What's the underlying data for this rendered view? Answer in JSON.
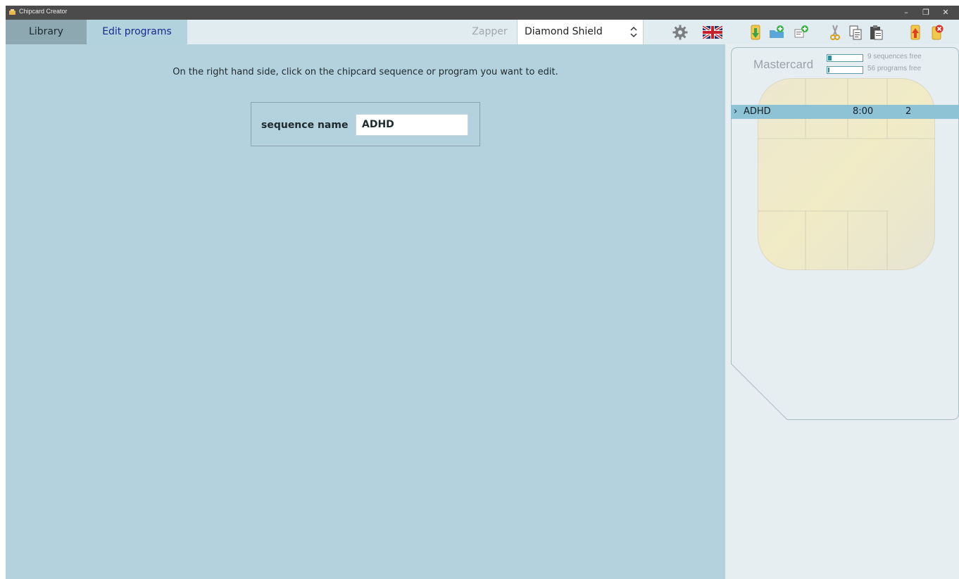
{
  "window": {
    "title": "Chipcard Creator",
    "controls": {
      "minimize": "–",
      "maximize": "❐",
      "close": "✕"
    }
  },
  "tabs": [
    {
      "label": "Library",
      "active": false
    },
    {
      "label": "Edit programs",
      "active": true
    }
  ],
  "zapper": {
    "label": "Zapper",
    "selected": "Diamond Shield"
  },
  "toolbar": {
    "icons": [
      "settings-gear-icon",
      "uk-flag-icon",
      "import-card-icon",
      "new-folder-icon",
      "new-program-icon",
      "cut-icon",
      "copy-icon",
      "paste-icon",
      "upload-card-icon",
      "delete-card-icon"
    ]
  },
  "main": {
    "instruction": "On the right hand side, click on the chipcard sequence or program you want to edit.",
    "sequence_name_label": "sequence name",
    "sequence_name_value": "ADHD"
  },
  "mastercard": {
    "title": "Mastercard",
    "sequences_free": "9 sequences free",
    "programs_free": "56 programs free",
    "sequences_used_fraction": 0.1,
    "programs_used_fraction": 0.02,
    "sequences": [
      {
        "name": "ADHD",
        "time": "8:00",
        "count": "2",
        "selected": true
      }
    ]
  },
  "colors": {
    "main_bg": "#b3d2de",
    "tab_active_bg": "#b2d2de",
    "tab_inactive_bg": "#8ea8b2",
    "selected_row": "#8ec3d5"
  }
}
